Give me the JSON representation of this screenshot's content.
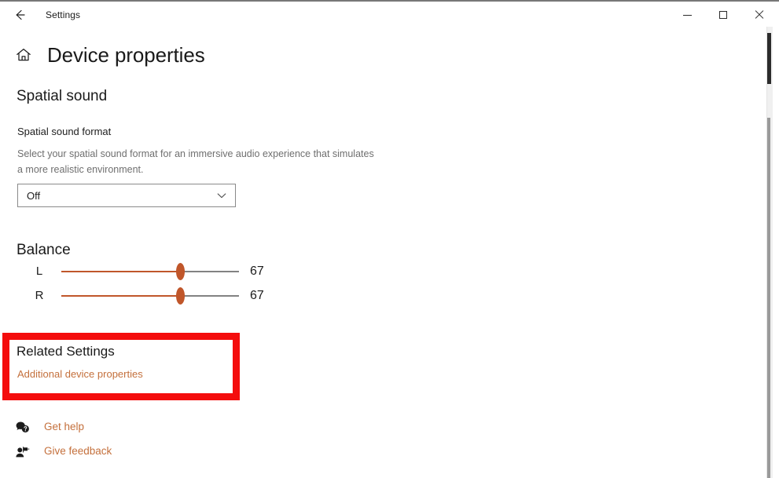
{
  "window": {
    "app_title": "Settings",
    "back_icon": "back-arrow-icon",
    "minimize_label": "—",
    "maximize_label": "□",
    "close_label": "✕"
  },
  "page": {
    "home_icon": "home-icon",
    "title": "Device properties"
  },
  "spatial_sound": {
    "section_title": "Spatial sound",
    "format_label": "Spatial sound format",
    "format_description": "Select your spatial sound format for an immersive audio experience that simulates a more realistic environment.",
    "format_value": "Off",
    "chevron_icon": "chevron-down-icon"
  },
  "balance": {
    "section_title": "Balance",
    "channels": [
      {
        "label": "L",
        "value": "67",
        "percent": 67
      },
      {
        "label": "R",
        "value": "67",
        "percent": 67
      }
    ]
  },
  "related_settings": {
    "title": "Related Settings",
    "link_label": "Additional device properties",
    "highlight_color": "#f40d0d",
    "link_color": "#c4703c"
  },
  "footer": {
    "links": [
      {
        "label": "Get help",
        "icon": "help-bubble-icon"
      },
      {
        "label": "Give feedback",
        "icon": "feedback-person-icon"
      }
    ]
  },
  "theme": {
    "accent": "#c0562a",
    "link": "#c4703c",
    "highlight": "#f40d0d",
    "track_inactive": "#828282"
  }
}
